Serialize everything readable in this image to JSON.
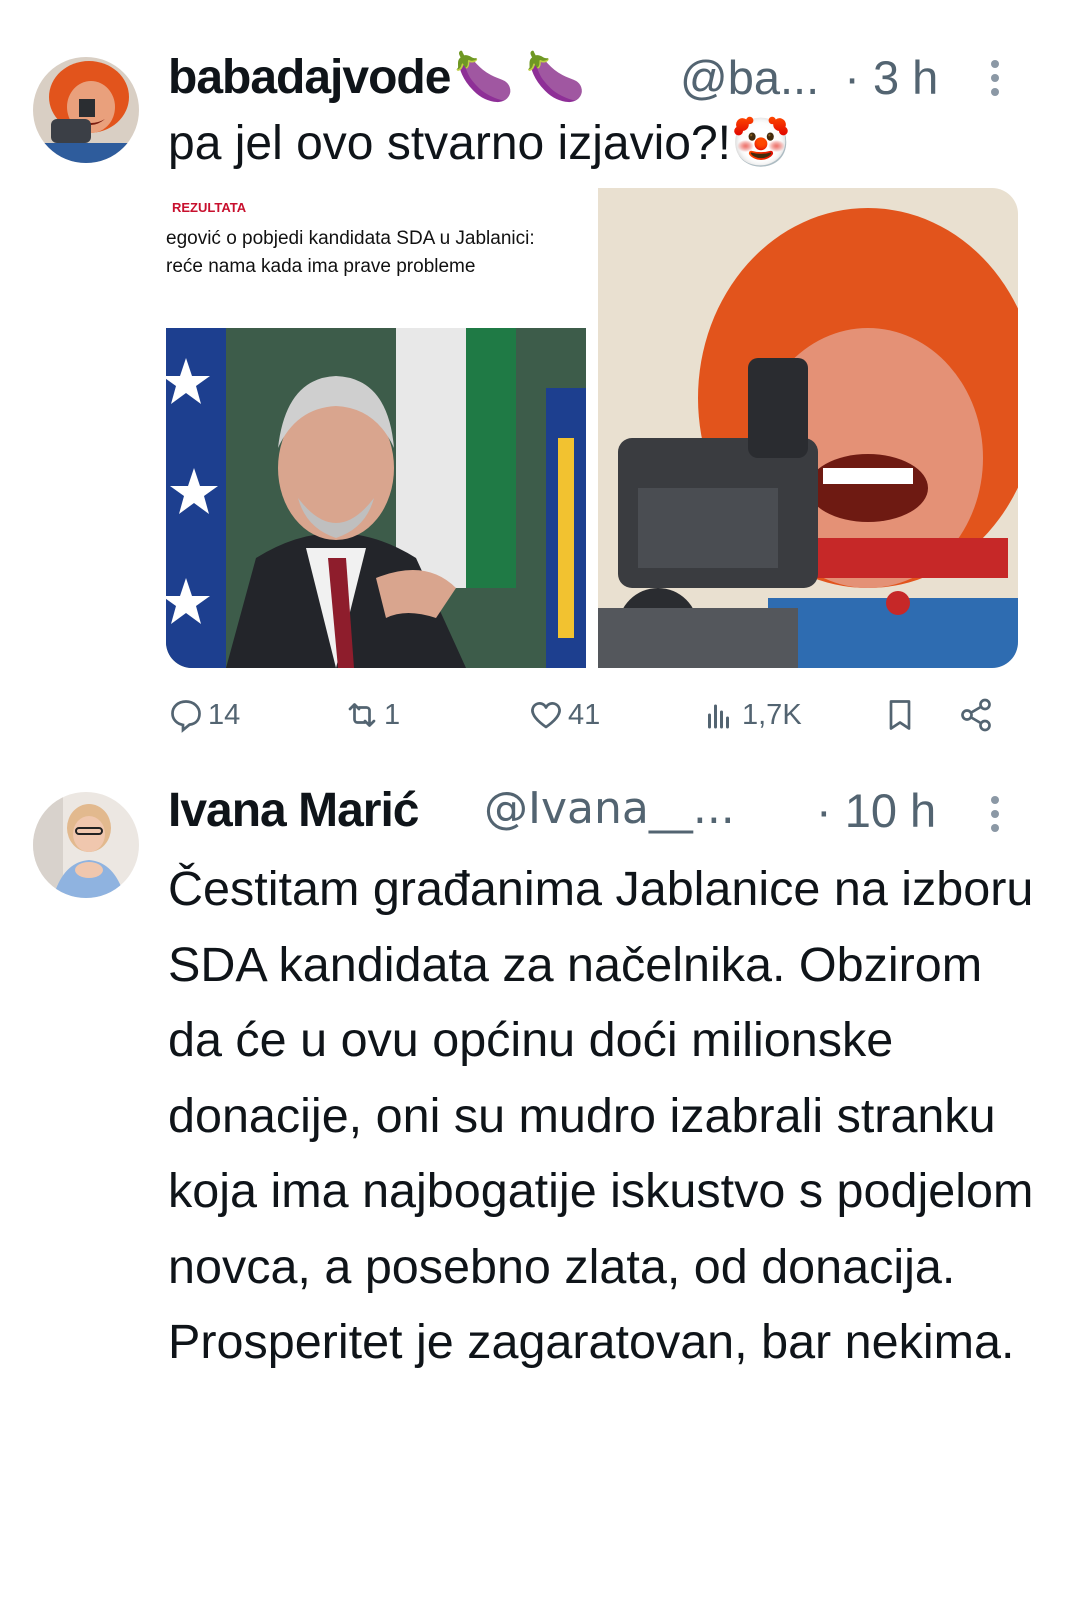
{
  "tweet1": {
    "display_name": "babadajvode",
    "name_emojis": "🍆 🍆",
    "handle": "@ba...",
    "time": "· 3 h",
    "text": "pa jel ovo stvarno izjavio?!🤡",
    "article": {
      "kicker": "REZULTATA",
      "headline_line1": "egović o pobjedi kandidata SDA u Jablanici:",
      "headline_line2": "reće nama kada ima prave probleme"
    },
    "stats": {
      "replies": "14",
      "reposts": "1",
      "likes": "41",
      "views": "1,7K"
    }
  },
  "tweet2": {
    "display_name": "Ivana Marić",
    "handle": "@Ivana__...",
    "time": "· 10 h",
    "paragraph1": "Čestitam građanima Jablanice na izboru SDA kandidata za načelnika. Obzirom da će u ovu općinu doći milionske donacije, oni su mudro izabrali stranku koja ima najbogatije iskustvo s podjelom novca, a posebno zlata, od donacija.",
    "paragraph2": "Prosperitet je zagaratovan, bar nekima."
  },
  "colors": {
    "text_primary": "#0f1419",
    "text_secondary": "#536471",
    "hair_orange": "#e2541c",
    "flag_blue": "#1d3f8f",
    "flag_green": "#1f7a45"
  },
  "icons": [
    "reply-icon",
    "repost-icon",
    "like-icon",
    "views-icon",
    "bookmark-icon",
    "share-icon",
    "more-icon"
  ]
}
